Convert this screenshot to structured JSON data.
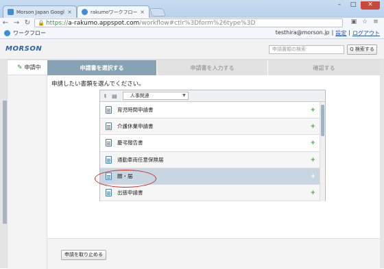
{
  "browser": {
    "tabs": [
      {
        "title": "Morson Japan Google Ap",
        "favicon_color": "#3d8fd6"
      },
      {
        "title": "rakumoワークフロー",
        "favicon_color": "#3d8fd6"
      }
    ],
    "url": {
      "https": "https://",
      "host": "a-rakumo.appspot.com",
      "path": "/workflow#ctlr%3Dform%26type%3D"
    }
  },
  "bookmarks": {
    "app_title": "ワークフロー",
    "user_email": "testhira@morson.jp",
    "settings": "設定",
    "logout": "ログアウト"
  },
  "header": {
    "logo": "MORSON",
    "search_placeholder": "申請書類の検索",
    "search_button": "Q 検索する"
  },
  "leftnav": {
    "item_label": "申請中"
  },
  "steps": {
    "select": "申請書を選択する",
    "input": "申請書を入力する",
    "confirm": "確認する"
  },
  "main": {
    "prompt": "申請したい書類を選んでください。",
    "category": "人事関連",
    "forms": [
      {
        "label": "育児時間申請書",
        "selected": false
      },
      {
        "label": "介護休業申請書",
        "selected": false
      },
      {
        "label": "慶弔報告書",
        "selected": false
      },
      {
        "label": "通勤車両任意保険届",
        "selected": false
      },
      {
        "label": "願・届",
        "selected": true
      },
      {
        "label": "出張申請書",
        "selected": false
      }
    ],
    "cancel_button": "申請を取り止める"
  },
  "colors": {
    "active_step": "#86a2b5",
    "selected_row": "#c8d6e1",
    "highlight_circle": "#d6281e",
    "plus": "#4a9a4a"
  }
}
